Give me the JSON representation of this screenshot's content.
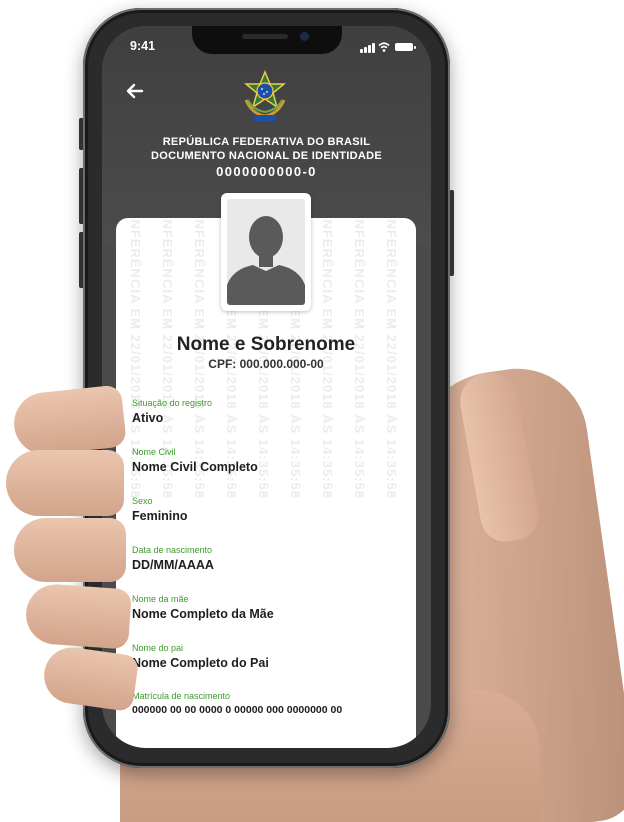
{
  "status_bar": {
    "time": "9:41"
  },
  "header": {
    "line1": "REPÚBLICA FEDERATIVA DO BRASIL",
    "line2": "DOCUMENTO NACIONAL DE IDENTIDADE",
    "doc_number": "0000000000-0"
  },
  "watermark_text": "CONFERÊNCIA EM 22/01/2018 ÀS 14:35:58",
  "person": {
    "name": "Nome e Sobrenome",
    "cpf": "CPF: 000.000.000-00"
  },
  "fields": [
    {
      "label": "Situação do registro",
      "value": "Ativo"
    },
    {
      "label": "Nome Civil",
      "value": "Nome Civil Completo"
    },
    {
      "label": "Sexo",
      "value": "Feminino"
    },
    {
      "label": "Data de nascimento",
      "value": "DD/MM/AAAA"
    },
    {
      "label": "Nome da mãe",
      "value": "Nome Completo da Mãe"
    },
    {
      "label": "Nome do pai",
      "value": "Nome Completo do Pai"
    },
    {
      "label": "Matrícula de nascimento",
      "value": "000000 00 00 0000 0 00000 000 0000000 00"
    }
  ],
  "colors": {
    "label_green": "#3f9a2e",
    "header_gray": "#4a4a4a",
    "card_white": "#ffffff"
  },
  "icons": [
    "back-arrow-icon",
    "signal-icon",
    "wifi-icon",
    "battery-icon",
    "coat-of-arms-icon",
    "avatar-silhouette-icon"
  ]
}
